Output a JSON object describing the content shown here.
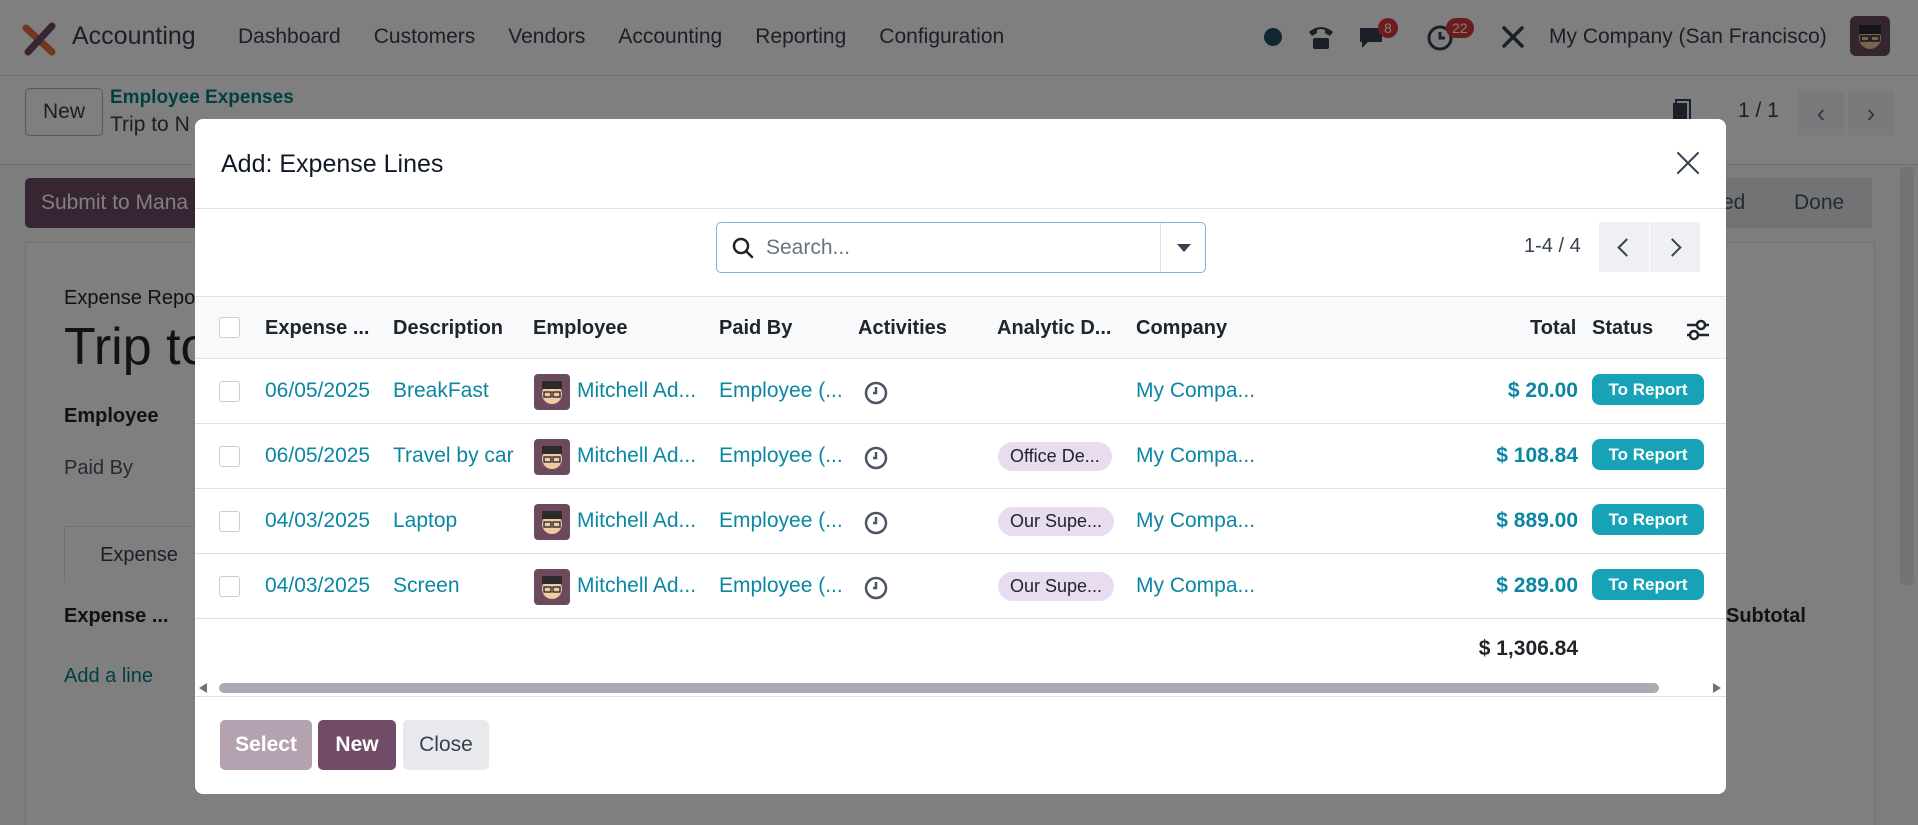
{
  "topbar": {
    "app_name": "Accounting",
    "menu": [
      "Dashboard",
      "Customers",
      "Vendors",
      "Accounting",
      "Reporting",
      "Configuration"
    ],
    "messages_badge": "8",
    "activities_badge": "22",
    "company": "My Company (San Francisco)"
  },
  "control_bar": {
    "new_label": "New",
    "breadcrumb_parent": "Employee Expenses",
    "breadcrumb_current": "Trip to N",
    "pager": "1 / 1"
  },
  "status_bar": {
    "submit_label": "Submit to Mana",
    "stage_partial": "ed",
    "stage_done": "Done"
  },
  "sheet": {
    "report_label": "Expense Repo",
    "report_title": "Trip to",
    "employee_label": "Employee",
    "paid_by_label": "Paid By",
    "tab_expense": "Expense",
    "col_expense": "Expense ...",
    "col_subtotal": "Subtotal",
    "add_line": "Add a line"
  },
  "modal": {
    "title": "Add: Expense Lines",
    "search_placeholder": "Search...",
    "pager": "1-4 / 4",
    "columns": [
      "Expense ...",
      "Description",
      "Employee",
      "Paid By",
      "Activities",
      "Analytic D...",
      "Company",
      "Total",
      "Status"
    ],
    "rows": [
      {
        "date": "06/05/2025",
        "description": "BreakFast",
        "employee": "Mitchell Ad...",
        "paid_by": "Employee (...",
        "analytic": "",
        "company": "My Compa...",
        "total": "$ 20.00",
        "status": "To Report"
      },
      {
        "date": "06/05/2025",
        "description": "Travel by car",
        "employee": "Mitchell Ad...",
        "paid_by": "Employee (...",
        "analytic": "Office De...",
        "company": "My Compa...",
        "total": "$ 108.84",
        "status": "To Report"
      },
      {
        "date": "04/03/2025",
        "description": "Laptop",
        "employee": "Mitchell Ad...",
        "paid_by": "Employee (...",
        "analytic": "Our Supe...",
        "company": "My Compa...",
        "total": "$ 889.00",
        "status": "To Report"
      },
      {
        "date": "04/03/2025",
        "description": "Screen",
        "employee": "Mitchell Ad...",
        "paid_by": "Employee (...",
        "analytic": "Our Supe...",
        "company": "My Compa...",
        "total": "$ 289.00",
        "status": "To Report"
      }
    ],
    "grand_total": "$ 1,306.84",
    "footer": {
      "select_label": "Select",
      "new_label": "New",
      "close_label": "Close"
    }
  },
  "colors": {
    "brand": "#714b67",
    "link": "#0b86a3",
    "status_badge": "#17a2b8",
    "analytic_tag": "#e7dcf0"
  }
}
